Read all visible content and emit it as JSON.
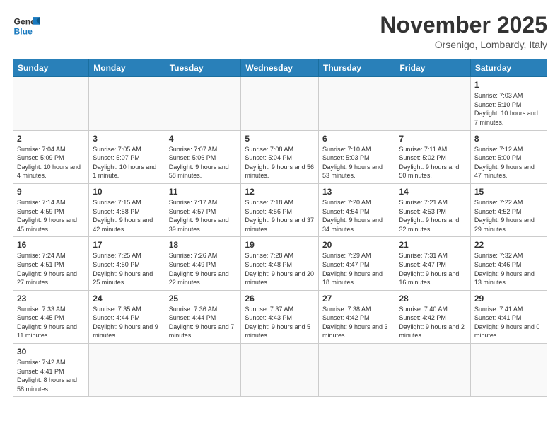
{
  "logo": {
    "line1": "General",
    "line2": "Blue"
  },
  "header": {
    "month": "November 2025",
    "location": "Orsenigo, Lombardy, Italy"
  },
  "weekdays": [
    "Sunday",
    "Monday",
    "Tuesday",
    "Wednesday",
    "Thursday",
    "Friday",
    "Saturday"
  ],
  "weeks": [
    [
      {
        "day": "",
        "info": ""
      },
      {
        "day": "",
        "info": ""
      },
      {
        "day": "",
        "info": ""
      },
      {
        "day": "",
        "info": ""
      },
      {
        "day": "",
        "info": ""
      },
      {
        "day": "",
        "info": ""
      },
      {
        "day": "1",
        "info": "Sunrise: 7:03 AM\nSunset: 5:10 PM\nDaylight: 10 hours and 7 minutes."
      }
    ],
    [
      {
        "day": "2",
        "info": "Sunrise: 7:04 AM\nSunset: 5:09 PM\nDaylight: 10 hours and 4 minutes."
      },
      {
        "day": "3",
        "info": "Sunrise: 7:05 AM\nSunset: 5:07 PM\nDaylight: 10 hours and 1 minute."
      },
      {
        "day": "4",
        "info": "Sunrise: 7:07 AM\nSunset: 5:06 PM\nDaylight: 9 hours and 58 minutes."
      },
      {
        "day": "5",
        "info": "Sunrise: 7:08 AM\nSunset: 5:04 PM\nDaylight: 9 hours and 56 minutes."
      },
      {
        "day": "6",
        "info": "Sunrise: 7:10 AM\nSunset: 5:03 PM\nDaylight: 9 hours and 53 minutes."
      },
      {
        "day": "7",
        "info": "Sunrise: 7:11 AM\nSunset: 5:02 PM\nDaylight: 9 hours and 50 minutes."
      },
      {
        "day": "8",
        "info": "Sunrise: 7:12 AM\nSunset: 5:00 PM\nDaylight: 9 hours and 47 minutes."
      }
    ],
    [
      {
        "day": "9",
        "info": "Sunrise: 7:14 AM\nSunset: 4:59 PM\nDaylight: 9 hours and 45 minutes."
      },
      {
        "day": "10",
        "info": "Sunrise: 7:15 AM\nSunset: 4:58 PM\nDaylight: 9 hours and 42 minutes."
      },
      {
        "day": "11",
        "info": "Sunrise: 7:17 AM\nSunset: 4:57 PM\nDaylight: 9 hours and 39 minutes."
      },
      {
        "day": "12",
        "info": "Sunrise: 7:18 AM\nSunset: 4:56 PM\nDaylight: 9 hours and 37 minutes."
      },
      {
        "day": "13",
        "info": "Sunrise: 7:20 AM\nSunset: 4:54 PM\nDaylight: 9 hours and 34 minutes."
      },
      {
        "day": "14",
        "info": "Sunrise: 7:21 AM\nSunset: 4:53 PM\nDaylight: 9 hours and 32 minutes."
      },
      {
        "day": "15",
        "info": "Sunrise: 7:22 AM\nSunset: 4:52 PM\nDaylight: 9 hours and 29 minutes."
      }
    ],
    [
      {
        "day": "16",
        "info": "Sunrise: 7:24 AM\nSunset: 4:51 PM\nDaylight: 9 hours and 27 minutes."
      },
      {
        "day": "17",
        "info": "Sunrise: 7:25 AM\nSunset: 4:50 PM\nDaylight: 9 hours and 25 minutes."
      },
      {
        "day": "18",
        "info": "Sunrise: 7:26 AM\nSunset: 4:49 PM\nDaylight: 9 hours and 22 minutes."
      },
      {
        "day": "19",
        "info": "Sunrise: 7:28 AM\nSunset: 4:48 PM\nDaylight: 9 hours and 20 minutes."
      },
      {
        "day": "20",
        "info": "Sunrise: 7:29 AM\nSunset: 4:47 PM\nDaylight: 9 hours and 18 minutes."
      },
      {
        "day": "21",
        "info": "Sunrise: 7:31 AM\nSunset: 4:47 PM\nDaylight: 9 hours and 16 minutes."
      },
      {
        "day": "22",
        "info": "Sunrise: 7:32 AM\nSunset: 4:46 PM\nDaylight: 9 hours and 13 minutes."
      }
    ],
    [
      {
        "day": "23",
        "info": "Sunrise: 7:33 AM\nSunset: 4:45 PM\nDaylight: 9 hours and 11 minutes."
      },
      {
        "day": "24",
        "info": "Sunrise: 7:35 AM\nSunset: 4:44 PM\nDaylight: 9 hours and 9 minutes."
      },
      {
        "day": "25",
        "info": "Sunrise: 7:36 AM\nSunset: 4:44 PM\nDaylight: 9 hours and 7 minutes."
      },
      {
        "day": "26",
        "info": "Sunrise: 7:37 AM\nSunset: 4:43 PM\nDaylight: 9 hours and 5 minutes."
      },
      {
        "day": "27",
        "info": "Sunrise: 7:38 AM\nSunset: 4:42 PM\nDaylight: 9 hours and 3 minutes."
      },
      {
        "day": "28",
        "info": "Sunrise: 7:40 AM\nSunset: 4:42 PM\nDaylight: 9 hours and 2 minutes."
      },
      {
        "day": "29",
        "info": "Sunrise: 7:41 AM\nSunset: 4:41 PM\nDaylight: 9 hours and 0 minutes."
      }
    ],
    [
      {
        "day": "30",
        "info": "Sunrise: 7:42 AM\nSunset: 4:41 PM\nDaylight: 8 hours and 58 minutes."
      },
      {
        "day": "",
        "info": ""
      },
      {
        "day": "",
        "info": ""
      },
      {
        "day": "",
        "info": ""
      },
      {
        "day": "",
        "info": ""
      },
      {
        "day": "",
        "info": ""
      },
      {
        "day": "",
        "info": ""
      }
    ]
  ]
}
